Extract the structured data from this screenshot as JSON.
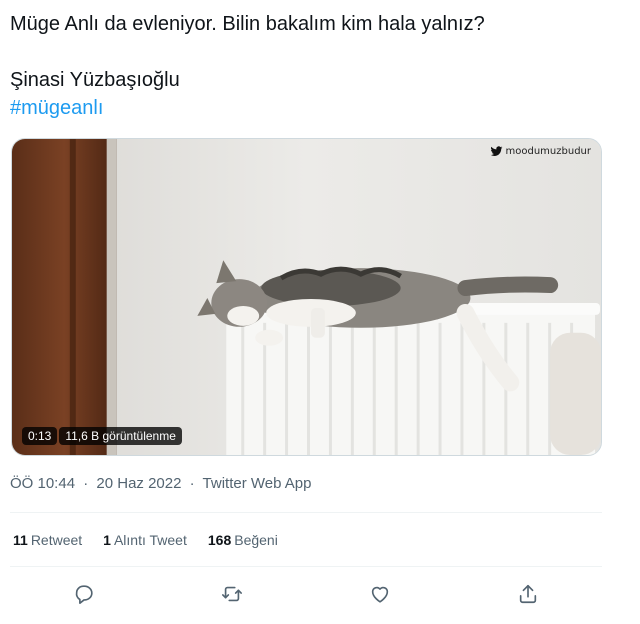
{
  "tweet": {
    "text_line1": "Müge Anlı da evleniyor. Bilin bakalım kim hala yalnız?",
    "text_line2": "Şinasi Yüzbaşıoğlu",
    "hashtag": "#mügeanlı"
  },
  "media": {
    "watermark": "moodumuzbudur",
    "duration": "0:13",
    "views": "11,6 B görüntülenme"
  },
  "meta": {
    "time": "ÖÖ 10:44",
    "date": "20 Haz 2022",
    "source": "Twitter Web App",
    "separator": "·"
  },
  "stats": {
    "retweets_count": "11",
    "retweets_label": "Retweet",
    "quotes_count": "1",
    "quotes_label": "Alıntı Tweet",
    "likes_count": "168",
    "likes_label": "Beğeni"
  },
  "actions": {
    "icons": [
      "reply-icon",
      "retweet-icon",
      "like-icon",
      "share-icon"
    ]
  },
  "colors": {
    "text": "#0f1419",
    "secondary": "#536471",
    "link": "#1d9bf0",
    "divider": "#eff3f4"
  }
}
